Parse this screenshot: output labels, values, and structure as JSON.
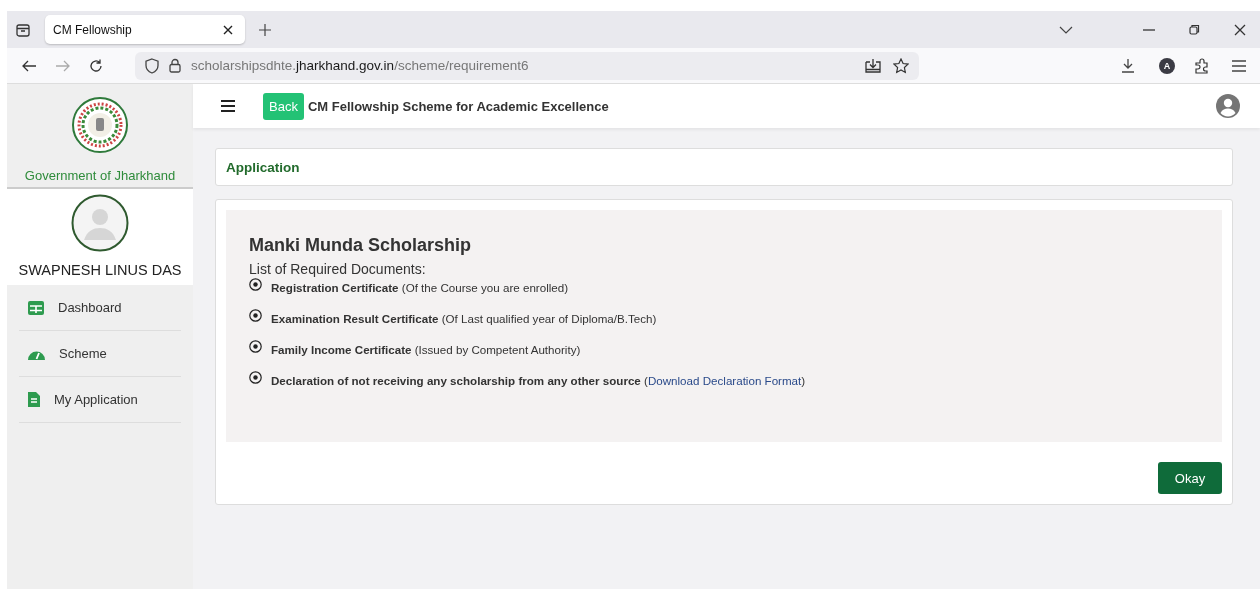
{
  "browser": {
    "tab": {
      "title": "CM Fellowship",
      "selected": true
    },
    "url": {
      "prefix": "scholarshipsdhte.",
      "domain": "jharkhand.gov.in",
      "path": "/scheme/requirement6"
    },
    "profile_letter": "A"
  },
  "sidebar": {
    "org": "Government of Jharkhand",
    "user": "SWAPNESH LINUS DAS",
    "items": [
      {
        "label": "Dashboard",
        "kind": "grid"
      },
      {
        "label": "Scheme",
        "kind": "gauge"
      },
      {
        "label": "My Application",
        "kind": "doc"
      }
    ]
  },
  "header": {
    "back": "Back",
    "title": "CM Fellowship Scheme for Academic Excellence"
  },
  "section_title": "Application",
  "scholarship": {
    "title": "Manki Munda Scholarship",
    "subtitle": "List of Required Documents:",
    "documents": [
      {
        "text": "**Registration Certificate** (Of the Course you are enrolled)"
      },
      {
        "text": "**Examination Result Certificate** (Of Last qualified year of Diploma/B.Tech)"
      },
      {
        "text": "**Family Income Certificate** (Issued by Competent Authority)"
      },
      {
        "text": "**Declaration of not receiving any scholarship from any other source** (",
        "link": "Download Declaration Format",
        "text_after": ")"
      }
    ]
  },
  "okay": "Okay"
}
